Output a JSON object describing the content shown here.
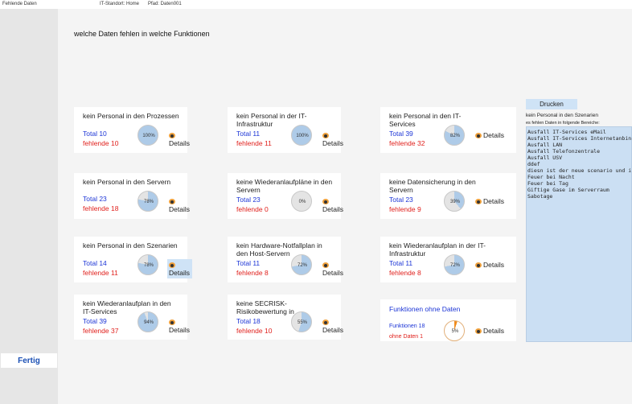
{
  "topbar": {
    "window_title": "Fehlende Daten",
    "standort": "IT-Standort: Home",
    "pfad": "Pfad:  Daten001"
  },
  "page_title": "welche Daten fehlen in welche Funktionen",
  "sidebar": {
    "fertig_label": "Fertig"
  },
  "details_label": "Details",
  "cards": [
    {
      "title": "kein Personal in den Prozessen",
      "total": "Total  10",
      "fehlende": "fehlende  10",
      "pct": "100%",
      "fraction": 1.0
    },
    {
      "title": "kein Personal in der IT-Infrastruktur",
      "total": "Total  11",
      "fehlende": "fehlende  11",
      "pct": "100%",
      "fraction": 1.0
    },
    {
      "title": "kein Personal in den IT-Services",
      "total": "Total  39",
      "fehlende": "fehlende  32",
      "pct": "82%",
      "fraction": 0.82
    },
    {
      "title": "kein Personal in den Servern",
      "total": "Total  23",
      "fehlende": "fehlende  18",
      "pct": "78%",
      "fraction": 0.78
    },
    {
      "title": "keine Wiederanlaufpläne in den Servern",
      "total": "Total  23",
      "fehlende": "fehlende  0",
      "pct": "0%",
      "fraction": 0.0
    },
    {
      "title": "keine Datensicherung in den Servern",
      "total": "Total  23",
      "fehlende": "fehlende  9",
      "pct": "39%",
      "fraction": 0.39
    },
    {
      "title": "kein Personal in den Szenarien",
      "total": "Total  14",
      "fehlende": "fehlende  11",
      "pct": "78%",
      "fraction": 0.78
    },
    {
      "title": "kein Hardware-Notfallplan in den Host-Servern",
      "total": "Total  11",
      "fehlende": "fehlende  8",
      "pct": "72%",
      "fraction": 0.72
    },
    {
      "title": "kein Wiederanlaufplan in der IT-Infrastruktur",
      "total": "Total  11",
      "fehlende": "fehlende  8",
      "pct": "72%",
      "fraction": 0.72
    },
    {
      "title": "kein Wiederanlaufplan in den IT-Services",
      "total": "Total  39",
      "fehlende": "fehlende  37",
      "pct": "94%",
      "fraction": 0.94
    },
    {
      "title": "keine SECRISK-Risikobewertung in",
      "total": "Total  18",
      "fehlende": "fehlende  10",
      "pct": "55%",
      "fraction": 0.55
    }
  ],
  "summary": {
    "title": "Funktionen ohne Daten",
    "funktionen": "Funktionen  18",
    "ohne": "ohne Daten  1",
    "pct": "5%",
    "fraction": 0.05
  },
  "right_panel": {
    "drucken_label": "Drucken",
    "szenarien_label": "kein Personal in den Szenarien",
    "hint": "es fehlen Daten in folgende Bereiche:",
    "items": [
      "Ausfall IT-Services eMail",
      "Ausfall IT-Services Internetanbindung",
      "Ausfall LAN",
      "Ausfall Telefonzentrale",
      "Ausfall USV",
      "ddef",
      "diesn ist der neue scenario und ich",
      "Feuer bei Nacht",
      "Feuer bei Tag",
      "Giftige Gase im Serverraum",
      "Sabotage"
    ]
  },
  "colors": {
    "pie_fill": "#aecbe8",
    "pie_rest": "#e4e4e4",
    "summary_fill": "#f08c1e",
    "summary_rest": "#ffffff",
    "total_text": "#1c35d6",
    "fehlende_text": "#e0201c"
  }
}
